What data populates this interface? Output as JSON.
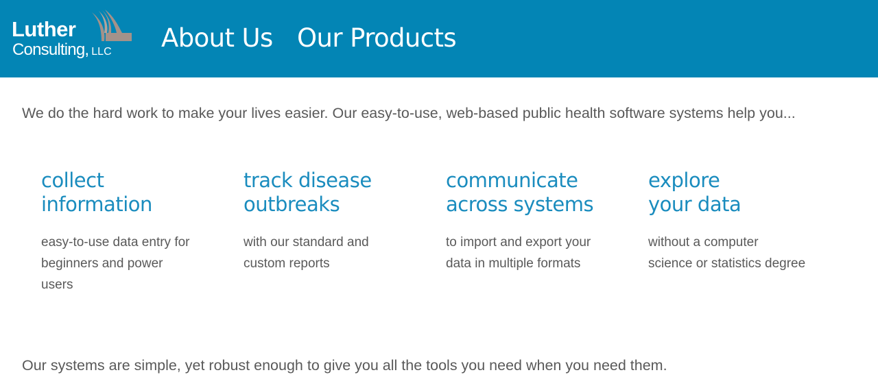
{
  "colors": {
    "header_bg": "#0385b5",
    "accent_text": "#1a8cbe",
    "body_text": "#595959",
    "logo_mark": "#a3928a"
  },
  "logo": {
    "line1": "Luther",
    "line2": "Consulting,",
    "suffix": "LLC",
    "mark_icon": "swoosh-square-icon"
  },
  "nav": {
    "items": [
      {
        "label": "About Us"
      },
      {
        "label": "Our Products"
      }
    ]
  },
  "main": {
    "intro": "We do the hard work to make your lives easier. Our easy-to-use, web-based public health software systems help you...",
    "features": [
      {
        "title_lines": [
          "collect",
          "information"
        ],
        "desc_lines": [
          "easy-to-use data entry for",
          "beginners and power",
          "users"
        ]
      },
      {
        "title_lines": [
          "track disease",
          "outbreaks"
        ],
        "desc_lines": [
          "with our standard and",
          "custom reports"
        ]
      },
      {
        "title_lines": [
          "communicate",
          "across systems"
        ],
        "desc_lines": [
          "to import and export your",
          "data in multiple formats"
        ]
      },
      {
        "title_lines": [
          "explore",
          "your data"
        ],
        "desc_lines": [
          "without a computer",
          "science or statistics degree"
        ]
      }
    ],
    "closing": "Our systems are simple, yet robust enough to give you all the tools you need when you need them."
  }
}
